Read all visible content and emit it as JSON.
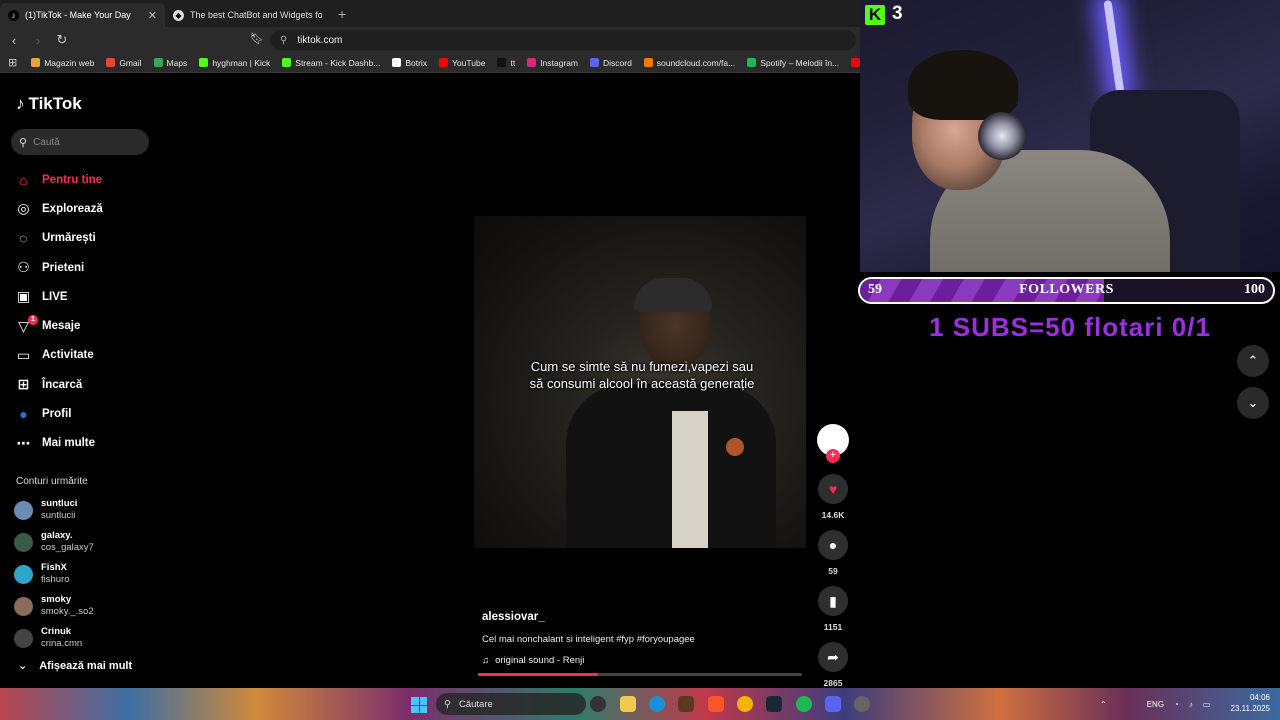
{
  "browser": {
    "tabs": [
      {
        "label": "(1)TikTok - Make Your Day",
        "close": "✕",
        "icon": "tiktok-icon"
      },
      {
        "label": "The best ChatBot and Widgets for Ki",
        "close": "",
        "icon": "botrix-icon"
      }
    ],
    "new_tab": "+",
    "url": "tiktok.com",
    "bookmarks": [
      {
        "label": "Magazin web",
        "color": "#e8a33c"
      },
      {
        "label": "Gmail",
        "color": "#ea4335"
      },
      {
        "label": "Maps",
        "color": "#34a853"
      },
      {
        "label": "hyghman | Kick",
        "color": "#53fc18"
      },
      {
        "label": "Stream - Kick Dashb...",
        "color": "#53fc18"
      },
      {
        "label": "Botrix",
        "color": "#ffffff"
      },
      {
        "label": "YouTube",
        "color": "#ff0000"
      },
      {
        "label": "tt",
        "color": "#111111"
      },
      {
        "label": "Instagram",
        "color": "#d62976"
      },
      {
        "label": "Discord",
        "color": "#5865f2"
      },
      {
        "label": "soundcloud.com/fa...",
        "color": "#ff7700"
      },
      {
        "label": "Spotify – Melodii în...",
        "color": "#1db954"
      },
      {
        "label": "N",
        "color": "#e50914"
      }
    ]
  },
  "tiktok": {
    "logo": "TikTok",
    "search_placeholder": "Caută",
    "nav": [
      {
        "label": "Pentru tine",
        "icon": "home-icon",
        "glyph": "⌂",
        "active": true
      },
      {
        "label": "Explorează",
        "icon": "compass-icon",
        "glyph": "◎"
      },
      {
        "label": "Urmărești",
        "icon": "following-avatar-icon",
        "glyph": "◌"
      },
      {
        "label": "Prieteni",
        "icon": "friends-icon",
        "glyph": "⚇"
      },
      {
        "label": "LIVE",
        "icon": "live-icon",
        "glyph": "▣"
      },
      {
        "label": "Mesaje",
        "icon": "messages-icon",
        "glyph": "▽",
        "badge": "1"
      },
      {
        "label": "Activitate",
        "icon": "activity-icon",
        "glyph": "▭"
      },
      {
        "label": "Încarcă",
        "icon": "upload-icon",
        "glyph": "⊞"
      },
      {
        "label": "Profil",
        "icon": "profile-avatar-icon",
        "glyph": "●"
      },
      {
        "label": "Mai multe",
        "icon": "more-icon",
        "glyph": "⋯"
      }
    ],
    "following_header": "Conturi urmărite",
    "following": [
      {
        "name": "suntluci",
        "handle": "suntlucii",
        "color": "#6b8cb0"
      },
      {
        "name": "galaxy.",
        "handle": "cos_galaxy7",
        "color": "#3a5a4a"
      },
      {
        "name": "FishX",
        "handle": "fishuro",
        "color": "#2fa6c9"
      },
      {
        "name": "smoky",
        "handle": "smoky._.so2",
        "color": "#8a6a5a"
      },
      {
        "name": "Crinuk",
        "handle": "crina.cmn",
        "color": "#444444"
      }
    ],
    "show_more": "Afișează mai mult",
    "video": {
      "caption": "Cum se simte să nu fumezi,vapezi sau să consumi alcool în această generație",
      "author": "alessiovar_",
      "description": "Cel mai nonchalant si inteligent #fyp #foryoupagee",
      "sound": "original sound - Renji",
      "progress": 0.37
    },
    "actions": {
      "likes": "14.6K",
      "comments": "59",
      "saves": "1151",
      "shares": "2865"
    }
  },
  "overlay": {
    "kick_logo": "K",
    "viewer_count": "3",
    "goal": {
      "start": "59",
      "label": "FOLLOWERS",
      "end": "100",
      "progress": 0.59
    },
    "subs_text": "1 SUBS=50 flotari 0/1"
  },
  "taskbar": {
    "search_placeholder": "Căutare",
    "language": "ENG",
    "time": "04:06",
    "date": "23.11.2025"
  }
}
